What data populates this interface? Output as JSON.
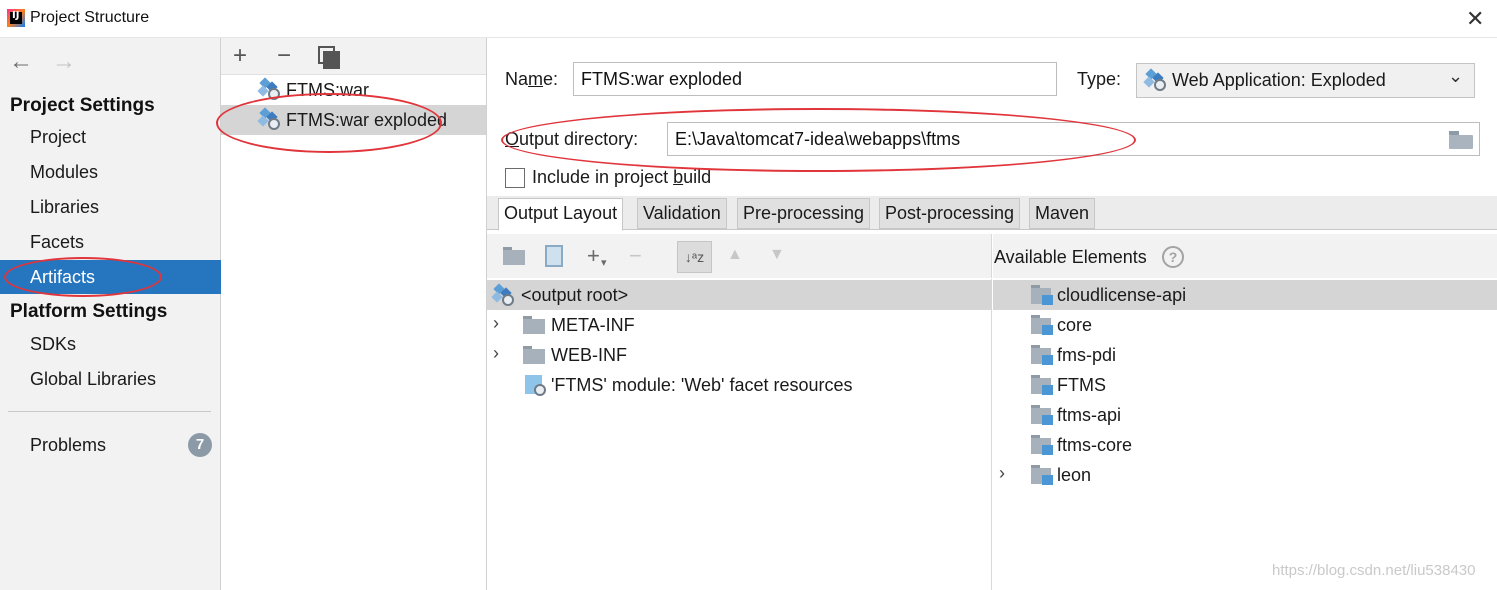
{
  "window": {
    "title": "Project Structure",
    "close_glyph": "✕"
  },
  "nav": {
    "back_glyph": "←",
    "forward_glyph": "→"
  },
  "sidebar": {
    "project_settings_title": "Project Settings",
    "project_items": [
      "Project",
      "Modules",
      "Libraries",
      "Facets",
      "Artifacts"
    ],
    "selected_item": "Artifacts",
    "platform_settings_title": "Platform Settings",
    "platform_items": [
      "SDKs",
      "Global Libraries"
    ],
    "problems_label": "Problems",
    "problems_count": "7"
  },
  "artifacts_toolbar": {
    "add_glyph": "+",
    "remove_glyph": "−",
    "copy_icon": "copy-icon"
  },
  "artifacts": [
    {
      "name": "FTMS:war",
      "selected": false
    },
    {
      "name": "FTMS:war exploded",
      "selected": true
    }
  ],
  "form": {
    "name_label_pre": "Na",
    "name_label_u": "m",
    "name_label_post": "e:",
    "name_value": "FTMS:war exploded",
    "type_label": "Type:",
    "type_value": "Web Application: Exploded",
    "type_chevron": "⌄",
    "output_label_u": "O",
    "output_label_post": "utput directory:",
    "output_value": "E:\\Java\\tomcat7-idea\\webapps\\ftms",
    "include_label_pre": "Include in project ",
    "include_label_u": "b",
    "include_label_post": "uild",
    "include_checked": false
  },
  "tabs": [
    {
      "label": "Output Layout",
      "active": true
    },
    {
      "label": "Validation",
      "active": false
    },
    {
      "label": "Pre-processing",
      "active": false
    },
    {
      "label": "Post-processing",
      "active": false
    },
    {
      "label": "Maven",
      "active": false
    }
  ],
  "layout_toolbar": {
    "new_dir_icon": "new-directory-icon",
    "archive_icon": "archive-icon",
    "add_glyph": "+",
    "add_dropdown_glyph": "▾",
    "remove_glyph": "−",
    "sort_glyph": "↓ᵃz",
    "up_glyph": "▲",
    "down_glyph": "▼"
  },
  "output_tree": {
    "root": "<output root>",
    "expand_glyph": "›",
    "children": [
      "META-INF",
      "WEB-INF",
      "'FTMS' module: 'Web' facet resources"
    ]
  },
  "available": {
    "title": "Available Elements",
    "help_glyph": "?",
    "expand_glyph": "›",
    "items": [
      "cloudlicense-api",
      "core",
      "fms-pdi",
      "FTMS",
      "ftms-api",
      "ftms-core",
      "leon"
    ],
    "selected": "cloudlicense-api"
  },
  "colors": {
    "selection_blue": "#2675bf",
    "annotation_red": "#e0353b",
    "row_selected_gray": "#d5d5d5"
  },
  "watermark": "https://blog.csdn.net/liu538430"
}
